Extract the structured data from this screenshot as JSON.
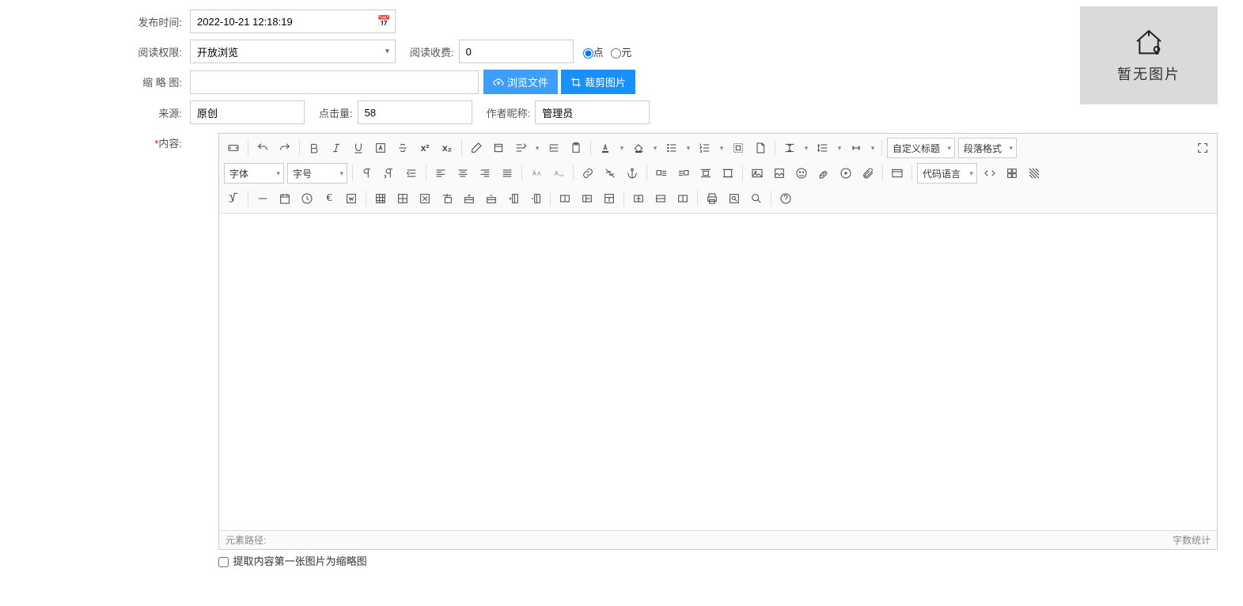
{
  "labels": {
    "publishTime": "发布时间:",
    "readPerm": "阅读权限:",
    "readFee": "阅读收费:",
    "thumbnail": "缩 略 图:",
    "source": "来源:",
    "hits": "点击量:",
    "author": "作者昵称:",
    "content": "内容:"
  },
  "values": {
    "publishTime": "2022-10-21 12:18:19",
    "readPerm": "开放浏览",
    "readFee": "0",
    "source": "原创",
    "hits": "58",
    "author": "管理员"
  },
  "radios": {
    "point": "点",
    "yuan": "元"
  },
  "buttons": {
    "browse": "浏览文件",
    "crop": "裁剪图片"
  },
  "placeholder": {
    "noImage": "暂无图片"
  },
  "editor": {
    "customTitle": "自定义标题",
    "paraFormat": "段落格式",
    "font": "字体",
    "fontSize": "字号",
    "codeLang": "代码语言",
    "elemPath": "元素路径:",
    "wordCount": "字数统计"
  },
  "checkbox": {
    "extractFirstImg": "提取内容第一张图片为缩略图"
  }
}
